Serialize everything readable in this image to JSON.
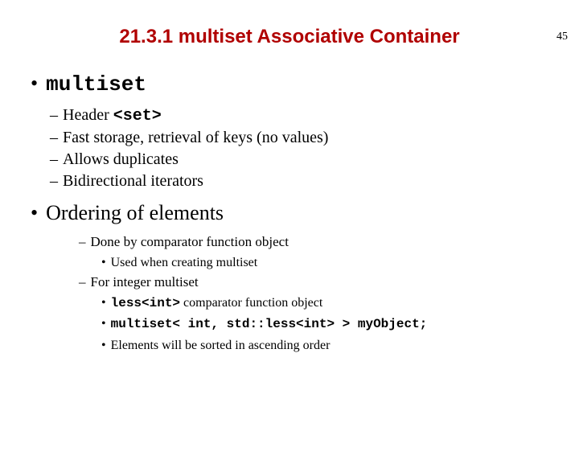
{
  "page_number": "45",
  "title": "21.3.1 multiset Associative Container",
  "items": [
    {
      "bullet": "•",
      "text_mono": "multiset",
      "sub": [
        {
          "dash": "–",
          "prefix": "Header ",
          "mono": "<set>"
        },
        {
          "dash": "–",
          "text": "Fast storage, retrieval of keys (no values)"
        },
        {
          "dash": "–",
          "text": "Allows duplicates"
        },
        {
          "dash": "–",
          "text": "Bidirectional iterators"
        }
      ]
    },
    {
      "bullet": "•",
      "text": "Ordering of elements",
      "sub": [
        {
          "dash": "–",
          "text": "Done by comparator function object",
          "sub": [
            {
              "dot": "•",
              "text": "Used when creating multiset"
            }
          ]
        },
        {
          "dash": "–",
          "text": "For integer multiset",
          "sub": [
            {
              "dot": "•",
              "mono": "less<int>",
              "suffix": " comparator function object"
            },
            {
              "dot": "•",
              "mono": "multiset< int, std::less<int> > myObject;"
            },
            {
              "dot": "•",
              "text": "Elements will be sorted in ascending order"
            }
          ]
        }
      ]
    }
  ]
}
